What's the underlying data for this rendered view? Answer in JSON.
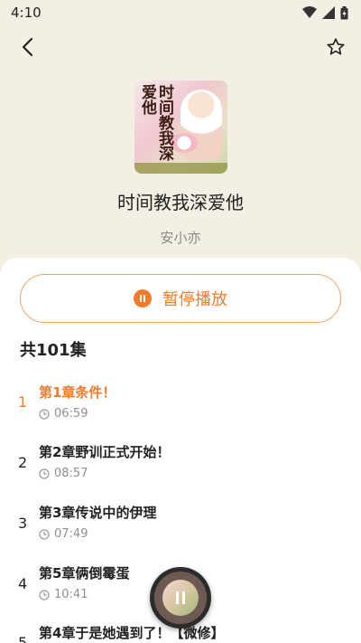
{
  "status": {
    "time": "4:10"
  },
  "book": {
    "title": "时间教我深爱他",
    "author": "安小亦",
    "cover_text": "时间教我深爱他"
  },
  "controls": {
    "play_label": "暂停播放"
  },
  "list": {
    "count_label": "共101集",
    "episodes": [
      {
        "index": "1",
        "title": "第1章条件！",
        "duration": "06:59",
        "active": true
      },
      {
        "index": "2",
        "title": "第2章野训正式开始！",
        "duration": "08:57"
      },
      {
        "index": "3",
        "title": "第3章传说中的伊理",
        "duration": "07:49"
      },
      {
        "index": "4",
        "title": "第5章俩倒霉蛋",
        "duration": "10:41"
      },
      {
        "index": "5",
        "title": "第4章于是她遇到了！【微修】",
        "duration": ""
      }
    ]
  },
  "colors": {
    "accent": "#f47b2a",
    "background": "#f3efe4"
  }
}
